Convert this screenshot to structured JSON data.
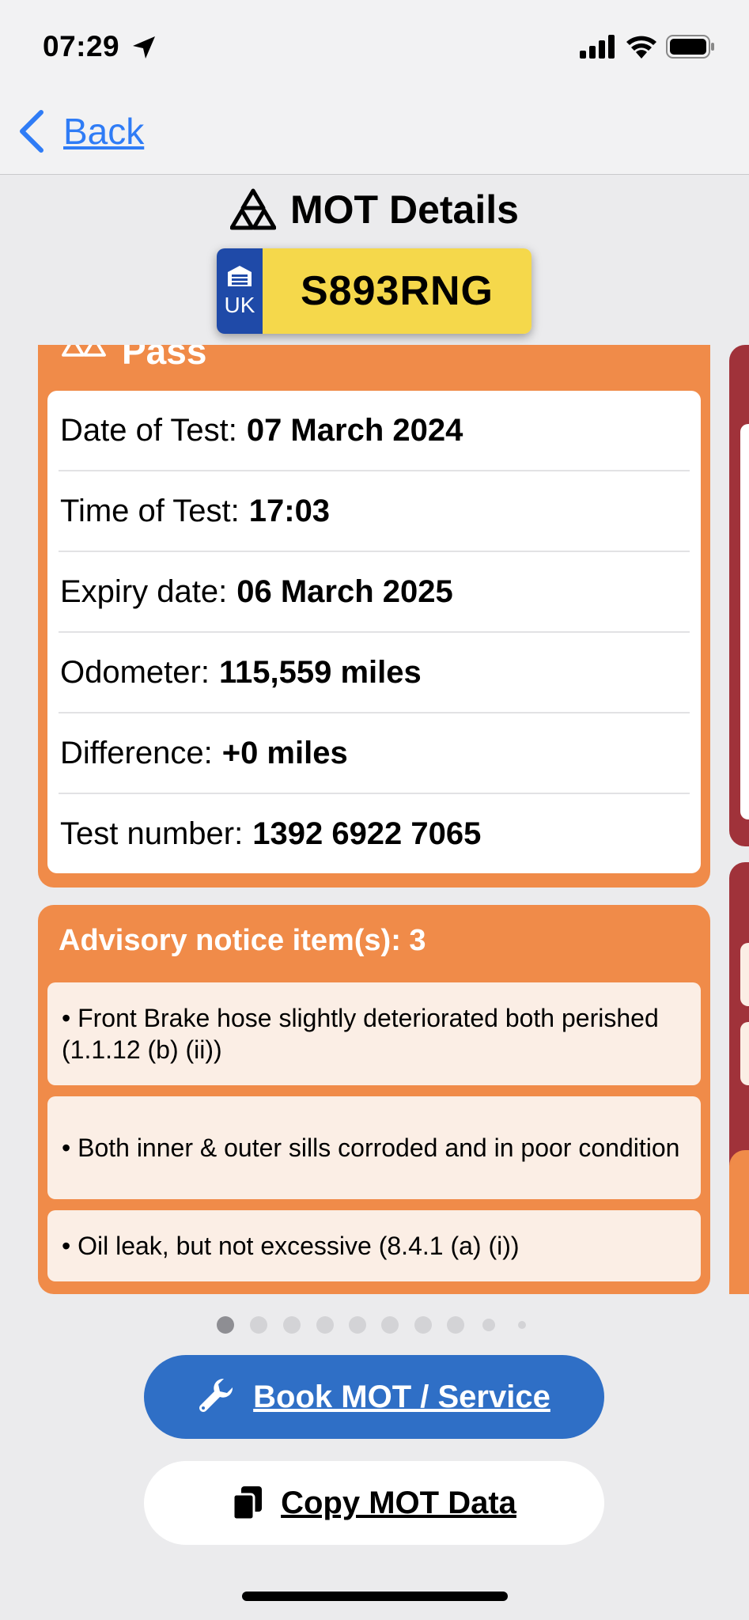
{
  "status_bar": {
    "time": "07:29"
  },
  "nav": {
    "back_label": "Back"
  },
  "header": {
    "title": "MOT Details"
  },
  "plate": {
    "country": "UK",
    "registration": "S893RNG"
  },
  "result": {
    "status": "Pass",
    "rows": [
      {
        "label": "Date of Test:",
        "value": "07 March 2024"
      },
      {
        "label": "Time of Test:",
        "value": "17:03"
      },
      {
        "label": "Expiry date:",
        "value": "06 March 2025"
      },
      {
        "label": "Odometer:",
        "value": "115,559 miles"
      },
      {
        "label": "Difference:",
        "value": "+0 miles"
      },
      {
        "label": "Test number:",
        "value": "1392 6922 7065"
      }
    ]
  },
  "advisory": {
    "title": "Advisory notice item(s): 3",
    "items": [
      "• Front Brake hose slightly deteriorated  both perished (1.1.12 (b) (ii))",
      "• Both inner & outer sills corroded and in poor condition",
      "• Oil leak, but not excessive (8.4.1 (a) (i))"
    ]
  },
  "pager": {
    "page_count": 10,
    "current_page": 1
  },
  "buttons": {
    "book_label": "Book MOT / Service",
    "copy_label": "Copy MOT Data"
  },
  "colors": {
    "pass_orange": "#f08b49",
    "fail_red": "#a0323a",
    "plate_yellow": "#f5d84b",
    "plate_blue": "#1f4aa8",
    "primary_blue": "#2f6fc6",
    "link_blue": "#2f7cf6"
  },
  "icons": {
    "location": "location-arrow-icon",
    "signal": "cellular-signal-icon",
    "wifi": "wifi-icon",
    "battery": "battery-icon",
    "back": "chevron-left-icon",
    "mot": "mot-triple-triangle-icon",
    "garage": "garage-icon",
    "wrench": "wrench-icon",
    "copy": "copy-icon"
  }
}
